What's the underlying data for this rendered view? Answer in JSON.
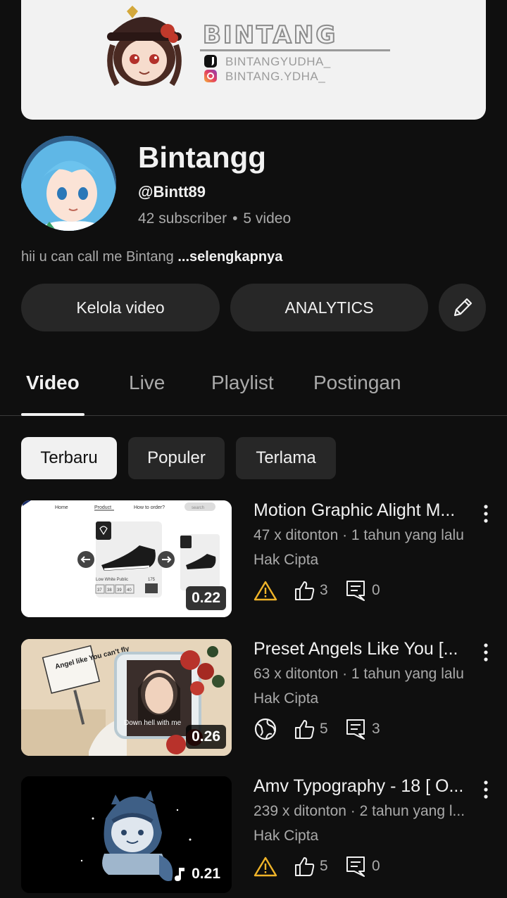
{
  "banner": {
    "title": "BINTANG",
    "handles": [
      "BINTANGYUDHA_",
      "BINTANG.YDHA_"
    ]
  },
  "channel": {
    "name": "Bintangg",
    "handle": "@Bintt89",
    "subscribers": "42 subscriber",
    "videos": "5 video",
    "separator": "•",
    "description": "hii u can call me Bintang",
    "more": "...selengkapnya"
  },
  "actions": {
    "manage": "Kelola video",
    "analytics": "ANALYTICS"
  },
  "tabs": [
    {
      "label": "Video",
      "active": true
    },
    {
      "label": "Live"
    },
    {
      "label": "Playlist"
    },
    {
      "label": "Postingan"
    }
  ],
  "chips": [
    {
      "label": "Terbaru",
      "selected": true
    },
    {
      "label": "Populer"
    },
    {
      "label": "Terlama"
    }
  ],
  "videos": [
    {
      "title": "Motion Graphic Alight M...",
      "meta": "47 x ditonton · 1 tahun yang lalu",
      "status": "Hak Cipta",
      "visibility_icon": "warning-icon",
      "likes": "3",
      "comments": "0",
      "duration": "0.22",
      "thumb_texts": [
        "Home",
        "Product",
        "How to order?",
        "search",
        "Low White Public",
        "175",
        "37",
        "38",
        "39",
        "40"
      ]
    },
    {
      "title": "Preset Angels Like You [...",
      "meta": "63 x ditonton · 1 tahun yang lalu",
      "status": "Hak Cipta",
      "visibility_icon": "globe-icon",
      "likes": "5",
      "comments": "3",
      "duration": "0.26",
      "thumb_texts": [
        "Angel like You can't fly",
        "Down hell with me"
      ]
    },
    {
      "title": "Amv Typography - 18 [ O...",
      "meta": "239 x ditonton · 2 tahun yang l...",
      "status": "Hak Cipta",
      "visibility_icon": "warning-icon",
      "likes": "5",
      "comments": "0",
      "duration": "0.21",
      "duration_icon": "music-note-icon"
    }
  ],
  "colors": {
    "background": "#0f0f0f",
    "surface": "#272727",
    "text": "#f1f1f1",
    "secondary_text": "#aaaaaa",
    "warning": "#f0b429"
  }
}
